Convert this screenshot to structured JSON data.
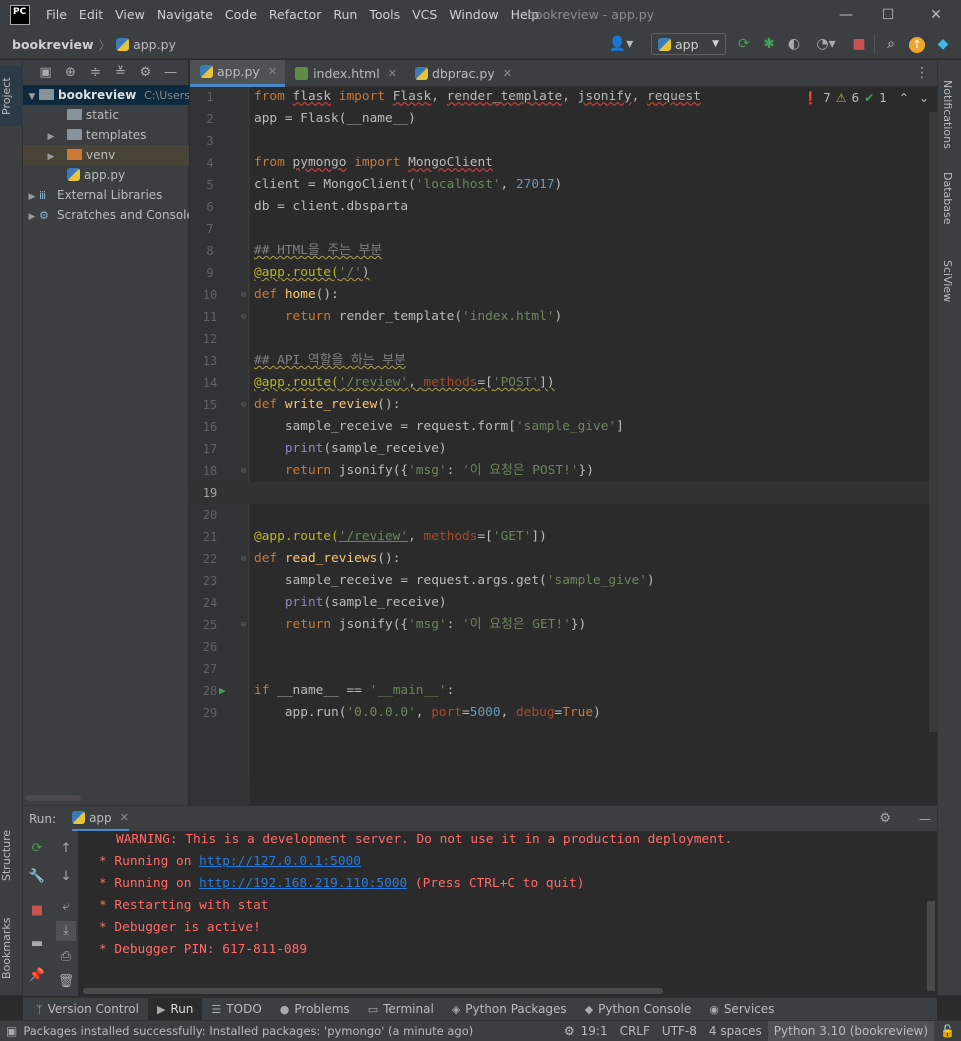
{
  "window": {
    "logo": "PC",
    "title": "bookreview - app.py",
    "menu": [
      "File",
      "Edit",
      "View",
      "Navigate",
      "Code",
      "Refactor",
      "Run",
      "Tools",
      "VCS",
      "Window",
      "Help"
    ],
    "controls": [
      "—",
      "☐",
      "✕"
    ]
  },
  "nav": {
    "project": "bookreview",
    "file": "app.py",
    "run_config": "app"
  },
  "left_strip": {
    "top": "Project",
    "middle": "Structure",
    "bottom": "Bookmarks"
  },
  "right_strip": [
    "Notifications",
    "Database",
    "SciView"
  ],
  "project_tree": [
    {
      "label": "bookreview",
      "suffix": "C:\\Users\\",
      "indent": 0,
      "arrow": "▼",
      "icon": "folder",
      "bold": true
    },
    {
      "label": "static",
      "indent": 1,
      "arrow": "",
      "icon": "folder"
    },
    {
      "label": "templates",
      "indent": 1,
      "arrow": "▶",
      "icon": "folder"
    },
    {
      "label": "venv",
      "indent": 1,
      "arrow": "▶",
      "icon": "folder-orange"
    },
    {
      "label": "app.py",
      "indent": 2,
      "arrow": "",
      "icon": "python"
    },
    {
      "label": "External Libraries",
      "indent": 0,
      "arrow": "▶",
      "icon": "libs"
    },
    {
      "label": "Scratches and Consoles",
      "indent": 0,
      "arrow": "▶",
      "icon": "libs"
    }
  ],
  "editor_tabs": [
    {
      "label": "app.py",
      "icon": "python",
      "active": true
    },
    {
      "label": "index.html",
      "icon": "html",
      "active": false
    },
    {
      "label": "dbprac.py",
      "icon": "python",
      "active": false
    }
  ],
  "inspections": {
    "errors": "7",
    "warnings": "6",
    "ok": "1"
  },
  "run": {
    "label": "Run:",
    "tab": "app",
    "output": [
      "WARNING: This is a development server. Do not use it in a production deployment.",
      "* Running on ",
      "http://127.0.0.1:5000",
      "* Running on ",
      "http://192.168.219.110:5000",
      " (Press CTRL+C to quit)",
      "* Restarting with stat",
      "* Debugger is active!",
      "* Debugger PIN: 617-811-089"
    ]
  },
  "bottom_tools": [
    {
      "label": "Version Control",
      "glyph": "ᛘ"
    },
    {
      "label": "Run",
      "glyph": "▶",
      "active": true
    },
    {
      "label": "TODO",
      "glyph": "☰"
    },
    {
      "label": "Problems",
      "glyph": "●"
    },
    {
      "label": "Terminal",
      "glyph": "▭"
    },
    {
      "label": "Python Packages",
      "glyph": "◈"
    },
    {
      "label": "Python Console",
      "glyph": "◆"
    },
    {
      "label": "Services",
      "glyph": "◉"
    }
  ],
  "status": {
    "message": "Packages installed successfully: Installed packages: 'pymongo' (a minute ago)",
    "position": "19:1",
    "line_sep": "CRLF",
    "encoding": "UTF-8",
    "indent": "4 spaces",
    "interpreter": "Python 3.10 (bookreview)"
  },
  "code_lines": [
    "from flask import Flask, render_template, jsonify, request",
    "app = Flask(__name__)",
    "",
    "from pymongo import MongoClient",
    "client = MongoClient('localhost', 27017)",
    "db = client.dbsparta",
    "",
    "## HTML을 주는 부분",
    "@app.route('/')",
    "def home():",
    "    return render_template('index.html')",
    "",
    "## API 역할을 하는 부분",
    "@app.route('/review', methods=['POST'])",
    "def write_review():",
    "    sample_receive = request.form['sample_give']",
    "    print(sample_receive)",
    "    return jsonify({'msg': '이 요청은 POST!'})",
    "",
    "",
    "@app.route('/review', methods=['GET'])",
    "def read_reviews():",
    "    sample_receive = request.args.get('sample_give')",
    "    print(sample_receive)",
    "    return jsonify({'msg': '이 요청은 GET!'})",
    "",
    "",
    "if __name__ == '__main__':",
    "    app.run('0.0.0.0', port=5000, debug=True)"
  ]
}
